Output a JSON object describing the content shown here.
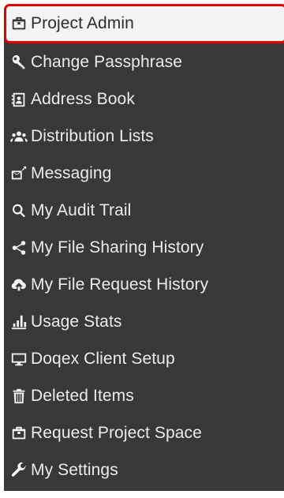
{
  "menu": {
    "items": [
      {
        "label": "Project Admin",
        "icon": "briefcase-icon",
        "active": true
      },
      {
        "label": "Change Passphrase",
        "icon": "key-icon"
      },
      {
        "label": "Address Book",
        "icon": "address-book-icon"
      },
      {
        "label": "Distribution Lists",
        "icon": "users-icon"
      },
      {
        "label": "Messaging",
        "icon": "envelope-icon"
      },
      {
        "label": "My Audit Trail",
        "icon": "search-icon"
      },
      {
        "label": "My File Sharing History",
        "icon": "share-icon"
      },
      {
        "label": "My File Request History",
        "icon": "cloud-upload-icon"
      },
      {
        "label": "Usage Stats",
        "icon": "bar-chart-icon"
      },
      {
        "label": "Doqex Client Setup",
        "icon": "monitor-icon"
      },
      {
        "label": "Deleted Items",
        "icon": "trash-icon"
      },
      {
        "label": "Request Project Space",
        "icon": "briefcase-icon"
      },
      {
        "label": "My Settings",
        "icon": "wrench-icon"
      }
    ]
  },
  "colors": {
    "menu_background": "#383838",
    "menu_text": "#ececec",
    "active_background": "#f4f4f4",
    "active_border": "#e50000"
  }
}
